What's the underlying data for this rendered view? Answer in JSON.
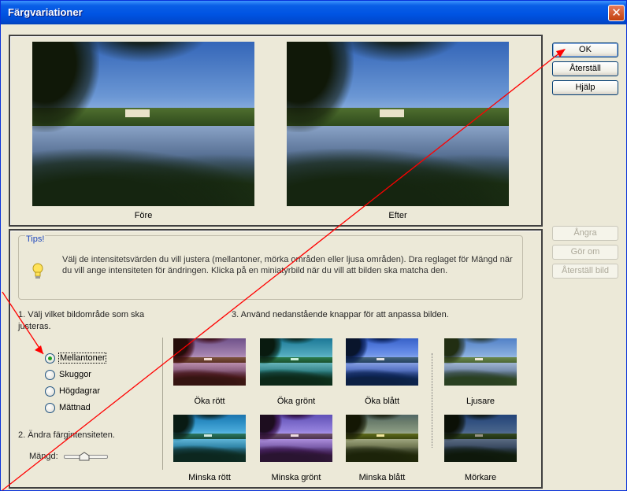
{
  "window": {
    "title": "Färgvariationer",
    "close_glyph": "✕"
  },
  "previews": {
    "before_label": "Före",
    "after_label": "Efter"
  },
  "tips": {
    "title": "Tips!",
    "text": "Välj de intensitetsvärden du vill justera (mellantoner, mörka områden eller ljusa områden). Dra reglaget för Mängd när du vill ange intensiteten för ändringen. Klicka på en miniatyrbild när du vill att bilden ska matcha den.",
    "icon": "lightbulb-icon"
  },
  "step1": {
    "text": "1. Välj vilket bildområde som ska justeras."
  },
  "regions": [
    {
      "label": "Mellantoner",
      "selected": true
    },
    {
      "label": "Skuggor",
      "selected": false
    },
    {
      "label": "Högdagrar",
      "selected": false
    },
    {
      "label": "Mättnad",
      "selected": false
    }
  ],
  "step2": {
    "text": "2. Ändra färgintensiteten.",
    "amount_label": "Mängd:",
    "amount_level": 0.45
  },
  "step3": {
    "text": "3. Använd nedanstående knappar för att anpassa bilden."
  },
  "variations": [
    {
      "label": "Öka rött",
      "tint": "#c0405a"
    },
    {
      "label": "Öka grönt",
      "tint": "#30c0a0"
    },
    {
      "label": "Öka blått",
      "tint": "#3050d0"
    },
    {
      "label": "Ljusare",
      "tint": "#ffffff"
    },
    {
      "label": "Minska rött",
      "tint": "#00a0c0"
    },
    {
      "label": "Minska grönt",
      "tint": "#a040c0"
    },
    {
      "label": "Minska blått",
      "tint": "#d0c040"
    },
    {
      "label": "Mörkare",
      "tint": "#000000"
    }
  ],
  "buttons": {
    "ok": "OK",
    "reset": "Återställ",
    "help": "Hjälp",
    "undo": "Ångra",
    "redo": "Gör om",
    "reset_image": "Återställ bild"
  },
  "colors": {
    "titlebar": "#0054e3",
    "dialog_bg": "#ece9d8",
    "annotation_arrow": "#ff0000",
    "tips_title": "#1f48bd"
  }
}
